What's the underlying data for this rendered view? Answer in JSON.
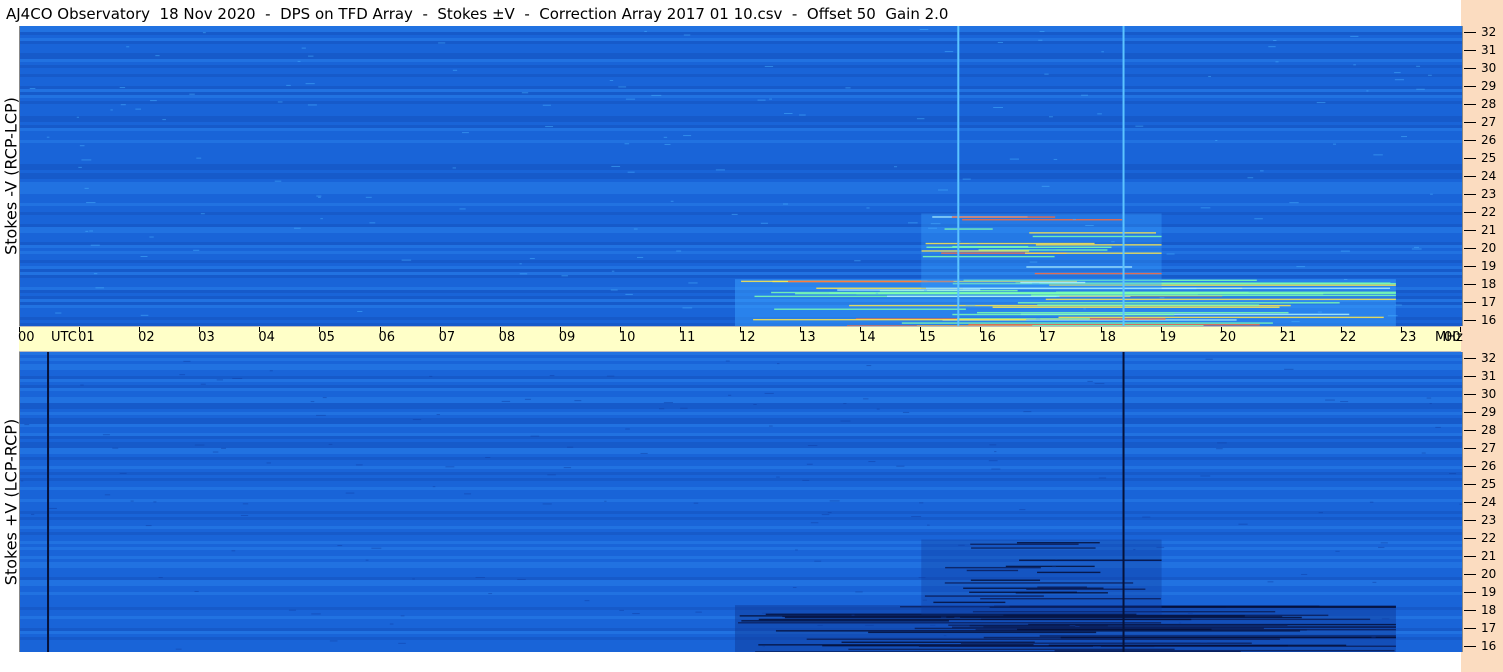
{
  "header": {
    "title": "AJ4CO Observatory  18 Nov 2020  -  DPS on TFD Array  -  Stokes ±V  -  Correction Array 2017 01 10.csv  -  Offset 50  Gain 2.0"
  },
  "time_axis": {
    "labels": [
      "00",
      "UTC",
      "01",
      "02",
      "03",
      "04",
      "05",
      "06",
      "07",
      "08",
      "09",
      "10",
      "11",
      "12",
      "13",
      "14",
      "15",
      "16",
      "17",
      "18",
      "19",
      "20",
      "21",
      "22",
      "23",
      "00",
      "MHz"
    ]
  },
  "colors": {
    "background_blue": "#1a64d8",
    "bright_blue": "#3aa0ff",
    "dark_band": "#0a2a7a",
    "axis_strip": "#ffffc8",
    "right_strip": "#fbdcc0"
  },
  "chart_data": [
    {
      "type": "heatmap",
      "title": "",
      "ylabel": "Stokes -V (RCP-LCP)",
      "xlabel": "",
      "x_range_utc_hours": [
        0,
        24
      ],
      "y_range_mhz": [
        16,
        32
      ],
      "y_ticks": [
        "32",
        "31",
        "30",
        "29",
        "28",
        "27",
        "26",
        "25",
        "24",
        "23",
        "22",
        "21",
        "20",
        "19",
        "18",
        "17",
        "16"
      ],
      "features": [
        {
          "kind": "emission",
          "utc_start": 11.9,
          "utc_end": 22.9,
          "mhz_low": 16,
          "mhz_high": 18.5,
          "intensity": "bright"
        },
        {
          "kind": "emission",
          "utc_start": 15.0,
          "utc_end": 19.0,
          "mhz_low": 18,
          "mhz_high": 22,
          "intensity": "moderate"
        },
        {
          "kind": "vertical_line",
          "utc": 18.35,
          "color": "bright"
        },
        {
          "kind": "vertical_line",
          "utc": 15.6,
          "color": "bright"
        }
      ]
    },
    {
      "type": "heatmap",
      "title": "",
      "ylabel": "Stokes +V (LCP-RCP)",
      "xlabel": "",
      "x_range_utc_hours": [
        0,
        24
      ],
      "y_range_mhz": [
        16,
        32
      ],
      "y_ticks": [
        "32",
        "31",
        "30",
        "29",
        "28",
        "27",
        "26",
        "25",
        "24",
        "23",
        "22",
        "21",
        "20",
        "19",
        "18",
        "17",
        "16"
      ],
      "features": [
        {
          "kind": "absorption",
          "utc_start": 11.9,
          "utc_end": 22.9,
          "mhz_low": 16,
          "mhz_high": 18.5,
          "intensity": "dark"
        },
        {
          "kind": "absorption",
          "utc_start": 15.0,
          "utc_end": 19.0,
          "mhz_low": 18,
          "mhz_high": 22,
          "intensity": "moderate"
        },
        {
          "kind": "vertical_line",
          "utc": 0.45,
          "color": "dark"
        },
        {
          "kind": "vertical_line",
          "utc": 18.35,
          "color": "dark"
        }
      ]
    }
  ]
}
